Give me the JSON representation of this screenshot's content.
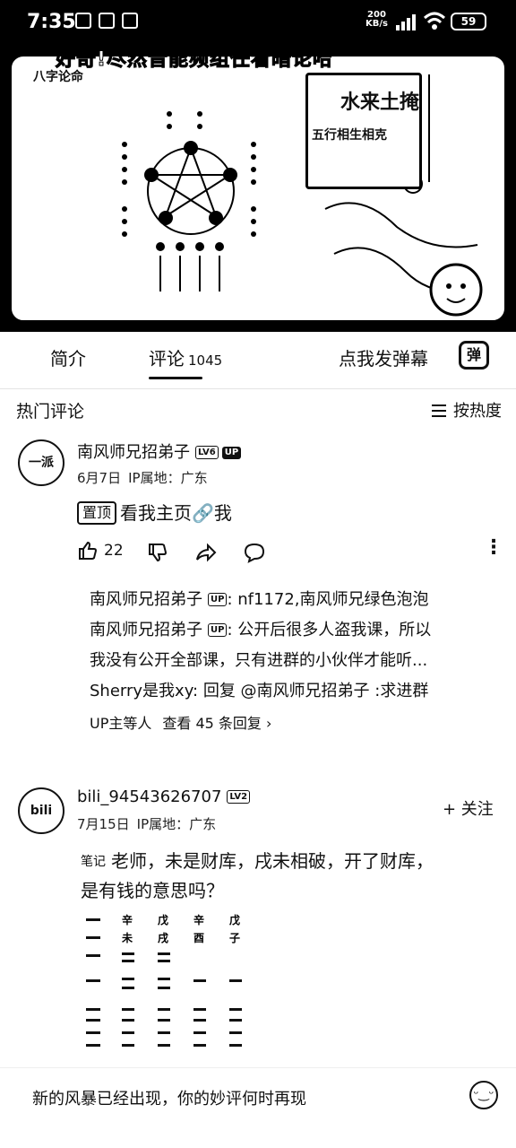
{
  "status_bar": {
    "time": "7:35",
    "net_speed_value": "200",
    "net_speed_unit": "KB/s",
    "battery": "59"
  },
  "video": {
    "caption": "好奇!尽然音能频组任看暗论哈",
    "chart_title": "八字论命",
    "card_line1": "水来土掩",
    "card_line2": "五行相生相克"
  },
  "tabs": {
    "intro": "简介",
    "comments": "评论",
    "comments_count": "1045",
    "danmaku_prompt": "点我发弹幕",
    "danmaku_icon": "弹"
  },
  "hot_header": {
    "title": "热门评论",
    "sort": "按热度"
  },
  "comments": [
    {
      "avatar_text": "一派",
      "user": "南风师兄招弟子",
      "level": "LV6",
      "up": "UP",
      "date": "6月7日",
      "ip": "IP属地：广东",
      "pin": "置顶",
      "text": "看我主页🔗我",
      "likes": "22"
    },
    {
      "avatar_text": "bili",
      "user": "bili_94543626707",
      "level": "LV2",
      "date": "7月15日",
      "ip": "IP属地：广东",
      "note": "笔记",
      "text_line1": "老师，未是财库，戌未相破，开了财库，",
      "text_line2": "是有钱的意思吗？",
      "follow": "+ 关注"
    }
  ],
  "replies": {
    "r1_name": "南风师兄招弟子",
    "r1_badge": "UP",
    "r1_text": ": nf1172,南风师兄绿色泡泡",
    "r2_name": "南风师兄招弟子",
    "r2_badge": "UP",
    "r2_text": ": 公开后很多人盗我课，所以",
    "r2_cont": "我没有公开全部课，只有进群的小伙伴才能听...",
    "r3_text": "Sherry是我xy: 回复 @南风师兄招弟子 :求进群",
    "foot_who": "UP主等人",
    "foot_view": "查看 45 条回复 ›"
  },
  "bazi": {
    "row1": [
      "辛",
      "戊",
      "辛",
      "戊"
    ],
    "row2": [
      "未",
      "戌",
      "酉",
      "子"
    ]
  },
  "bottom": {
    "input_hint": "新的风暴已经出现，你的妙评何时再现"
  }
}
